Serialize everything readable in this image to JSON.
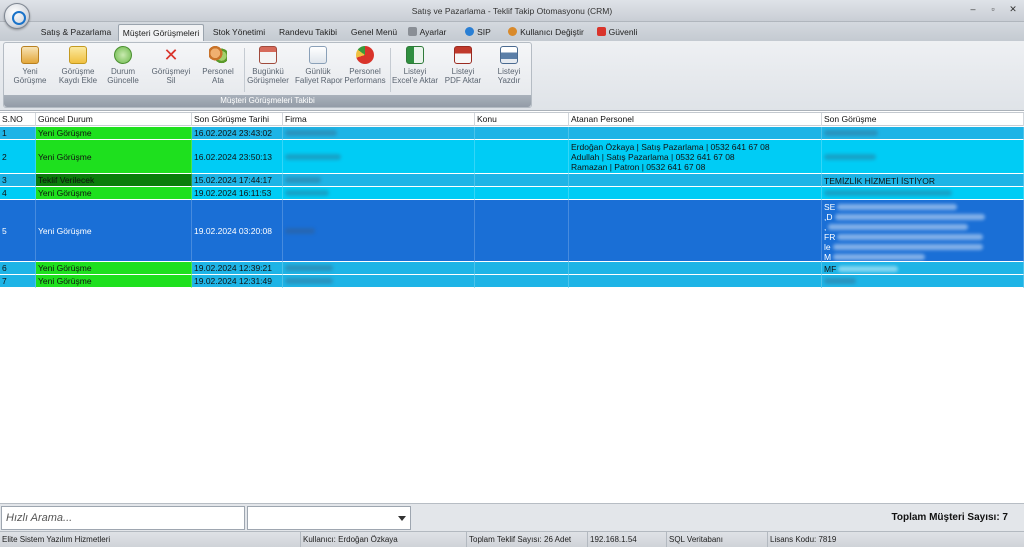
{
  "window": {
    "title": "Satış ve Pazarlama - Teklif Takip Otomasyonu (CRM)",
    "controls": [
      "–",
      "▫",
      "✕"
    ]
  },
  "tabs": [
    {
      "label": "Satış & Pazarlama",
      "active": false
    },
    {
      "label": "Müşteri Görüşmeleri",
      "active": true
    },
    {
      "label": "Stok Yönetimi",
      "active": false
    },
    {
      "label": "Randevu Takibi",
      "active": false
    },
    {
      "label": "Genel Menü",
      "active": false
    },
    {
      "label": "Ayarlar",
      "icon": "tools-icon"
    },
    {
      "label": "SIP Telefon",
      "icon": "phone-icon"
    },
    {
      "label": "Kullanıcı Değiştir",
      "icon": "user-switch-icon"
    },
    {
      "label": "Güvenli Çıkış",
      "icon": "exit-icon"
    }
  ],
  "ribbon": {
    "group_label": "Müşteri Görüşmeleri Takibi",
    "buttons": [
      {
        "line1": "Yeni",
        "line2": "Görüşme",
        "icon": "new-note-icon",
        "color": "#e3a73a"
      },
      {
        "line1": "Görüşme",
        "line2": "Kaydı Ekle",
        "icon": "star-folder-icon",
        "color": "#f0c040"
      },
      {
        "line1": "Durum",
        "line2": "Güncelle",
        "icon": "refresh-icon",
        "color": "#6bb84a"
      },
      {
        "line1": "Görüşmeyi",
        "line2": "Sil",
        "icon": "delete-x-icon",
        "color": "#d9342b"
      },
      {
        "line1": "Personel",
        "line2": "Ata",
        "icon": "group-icon",
        "color": "#c8732a"
      },
      {
        "line1": "Bugünkü",
        "line2": "Görüşmeler",
        "icon": "calendar-icon",
        "color": "#d66a5a"
      },
      {
        "line1": "Günlük",
        "line2": "Faliyet Rapor",
        "icon": "report-icon",
        "color": "#8aa0b8"
      },
      {
        "line1": "Personel",
        "line2": "Performans",
        "icon": "pie-chart-icon",
        "color": "#d9342b"
      },
      {
        "line1": "Listeyi",
        "line2": "Excel'e Aktar",
        "icon": "excel-icon",
        "color": "#2f8f3f"
      },
      {
        "line1": "Listeyi",
        "line2": "PDF Aktar",
        "icon": "pdf-icon",
        "color": "#c0392b"
      },
      {
        "line1": "Listeyi",
        "line2": "Yazdır",
        "icon": "printer-icon",
        "color": "#5b7fa8"
      }
    ]
  },
  "grid": {
    "columns": [
      "S.NO",
      "Güncel Durum",
      "Son Görüşme Tarihi",
      "Firma",
      "Konu",
      "Atanan Personel",
      "Son Görüşme"
    ],
    "rows": [
      {
        "no": "1",
        "status": "Yeni Görüşme",
        "date": "16.02.2024 23:43:02",
        "personel": [],
        "last": [],
        "row_color": "#1eb4e6",
        "status_color": "#1ee01e"
      },
      {
        "no": "2",
        "status": "Yeni Görüşme",
        "date": "16.02.2024 23:50:13",
        "personel": [
          "Erdoğan Özkaya | Satış Pazarlama | 0532 641 67 08",
          "Adullah | Satış Pazarlama | 0532 641 67 08",
          "Ramazan | Patron | 0532 641 67 08"
        ],
        "last": [],
        "row_color": "#00ccf5",
        "status_color": "#1ee01e"
      },
      {
        "no": "3",
        "status": "Teklif Verilecek",
        "date": "15.02.2024 17:44:17",
        "personel": [],
        "last": [
          "TEMİZLİK HİZMETİ İSTİYOR"
        ],
        "row_color": "#1eb4e6",
        "status_color": "#0b7d0b"
      },
      {
        "no": "4",
        "status": "Yeni Görüşme",
        "date": "19.02.2024 16:11:53",
        "personel": [],
        "last": [],
        "row_color": "#00ccf5",
        "status_color": "#1ee01e"
      },
      {
        "no": "5",
        "status": "Yeni Görüşme",
        "date": "19.02.2024 03:20:08",
        "personel": [],
        "last": [
          "SE",
          ",D",
          ",",
          "FR",
          "le",
          "M"
        ],
        "row_color": "#1a6fd6",
        "status_color": "#1a6fd6"
      },
      {
        "no": "6",
        "status": "Yeni Görüşme",
        "date": "19.02.2024 12:39:21",
        "personel": [],
        "last": [
          "MF"
        ],
        "row_color": "#1eb4e6",
        "status_color": "#1ee01e"
      },
      {
        "no": "7",
        "status": "Yeni Görüşme",
        "date": "19.02.2024 12:31:49",
        "personel": [],
        "last": [],
        "row_color": "#1eb4e6",
        "status_color": "#1ee01e"
      }
    ]
  },
  "bottom": {
    "search_placeholder": "Hızlı Arama...",
    "total_label": "Toplam Müşteri Sayısı: 7"
  },
  "status_bar": {
    "company": "Elite Sistem Yazılım Hizmetleri",
    "user": "Kullanıcı: Erdoğan Özkaya",
    "offers": "Toplam Teklif Sayısı: 26 Adet",
    "ip": "192.168.1.54",
    "db": "SQL Veritabanı",
    "license": "Lisans Kodu: 7819"
  }
}
